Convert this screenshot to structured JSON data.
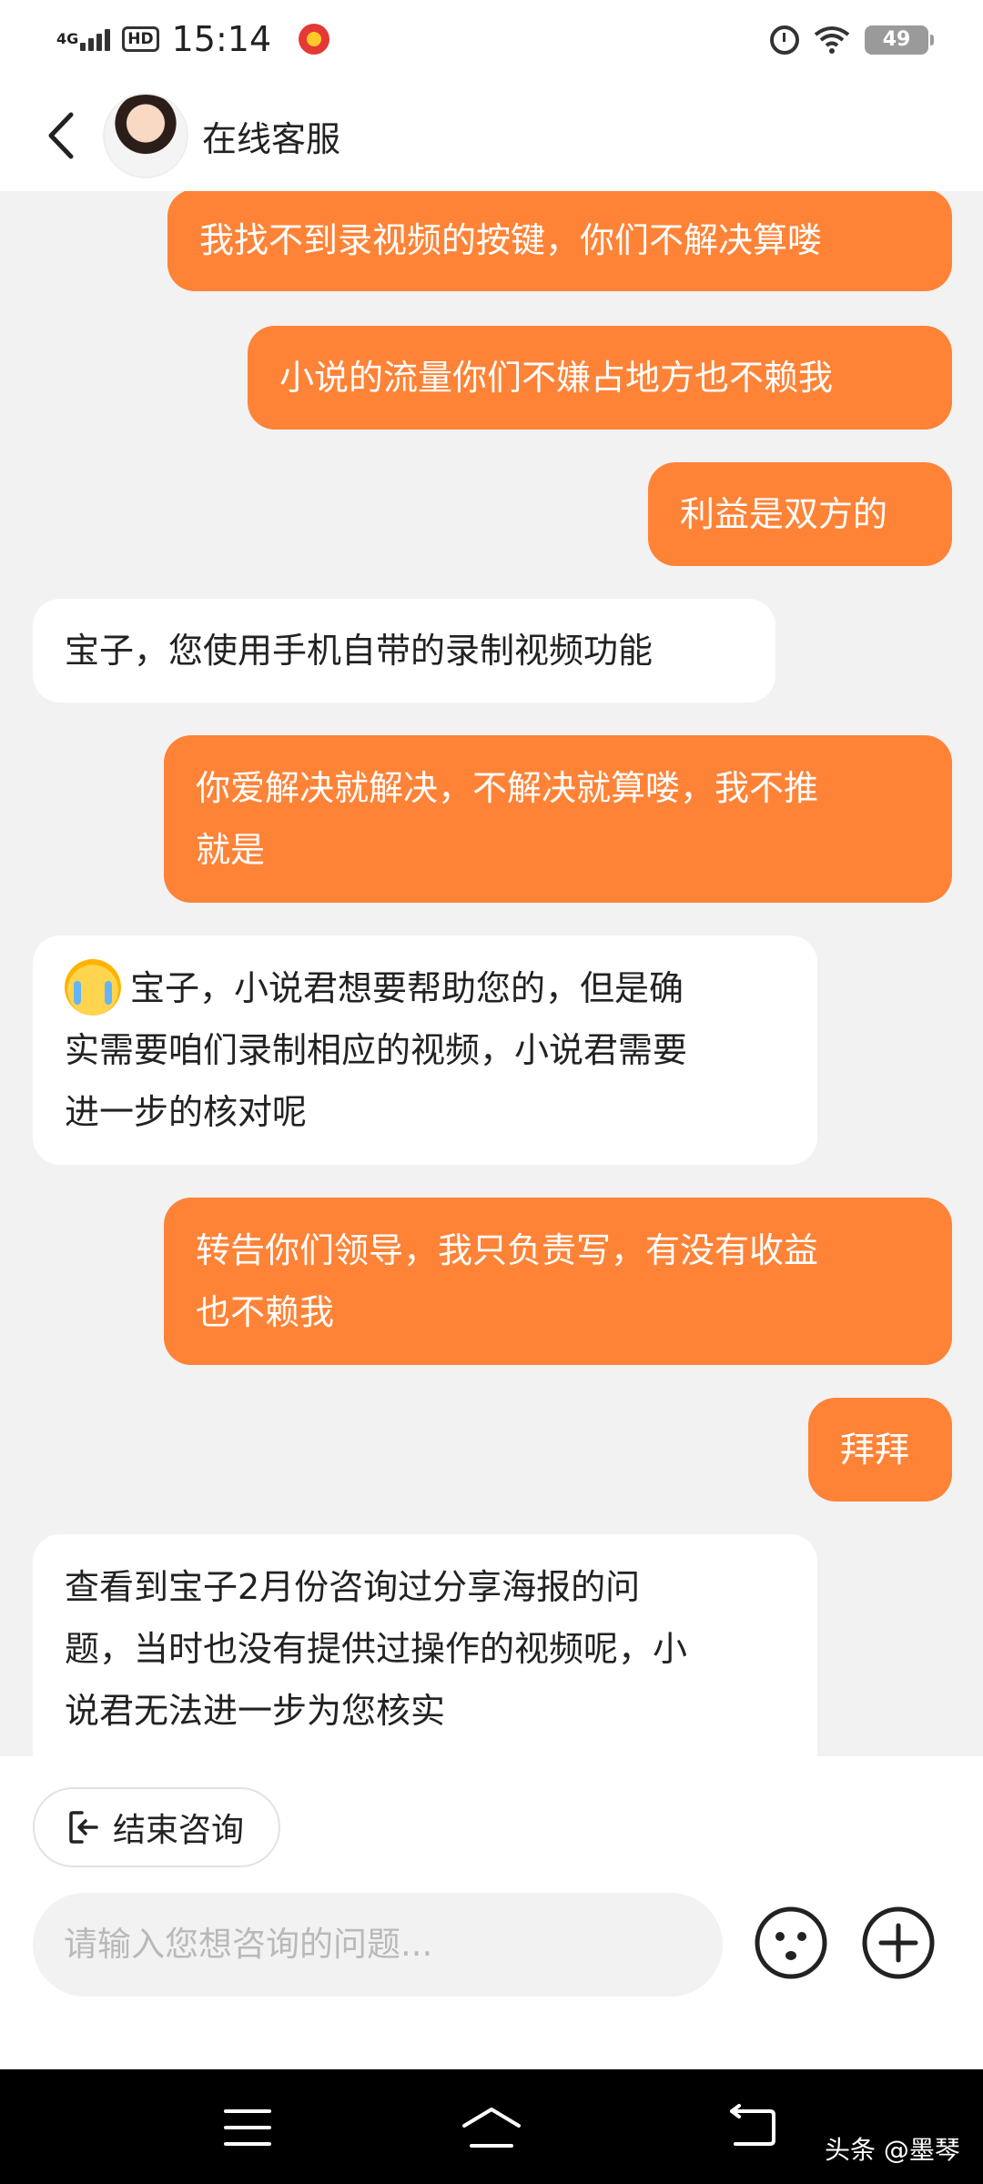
{
  "status_bar": {
    "network": "4G",
    "hd": "HD",
    "time": "15:14",
    "battery": "49"
  },
  "header": {
    "title": "在线客服"
  },
  "messages": [
    {
      "side": "out",
      "lines": [
        "我找不到录视频的按键，你们不解决算喽"
      ]
    },
    {
      "side": "out",
      "lines": [
        "小说的流量你们不嫌占地方也不赖我"
      ]
    },
    {
      "side": "out",
      "lines": [
        "利益是双方的"
      ]
    },
    {
      "side": "in",
      "lines": [
        "宝子，您使用手机自带的录制视频功能"
      ]
    },
    {
      "side": "out",
      "lines": [
        "你爱解决就解决，不解决就算喽，我不推",
        "就是"
      ]
    },
    {
      "side": "in",
      "emoji": "crying-face-emoji",
      "lines": [
        "宝子，小说君想要帮助您的，但是确",
        "实需要咱们录制相应的视频，小说君需要",
        "进一步的核对呢"
      ]
    },
    {
      "side": "out",
      "lines": [
        "转告你们领导，我只负责写，有没有收益",
        "也不赖我"
      ]
    },
    {
      "side": "out",
      "lines": [
        "拜拜"
      ]
    },
    {
      "side": "in",
      "lines": [
        "查看到宝子2月份咨询过分享海报的问",
        "题，当时也没有提供过操作的视频呢，小",
        "说君无法进一步为您核实"
      ]
    }
  ],
  "bottom": {
    "end_label": "结束咨询",
    "input_placeholder": "请输入您想咨询的问题..."
  },
  "icons": {
    "back": "chevron-left-icon",
    "emoji": "smiley-icon",
    "plus": "plus-circle-icon",
    "end": "exit-icon"
  },
  "colors": {
    "accent": "#fe8337",
    "background": "#f2f2f2"
  },
  "watermark": "头条 @墨琴"
}
